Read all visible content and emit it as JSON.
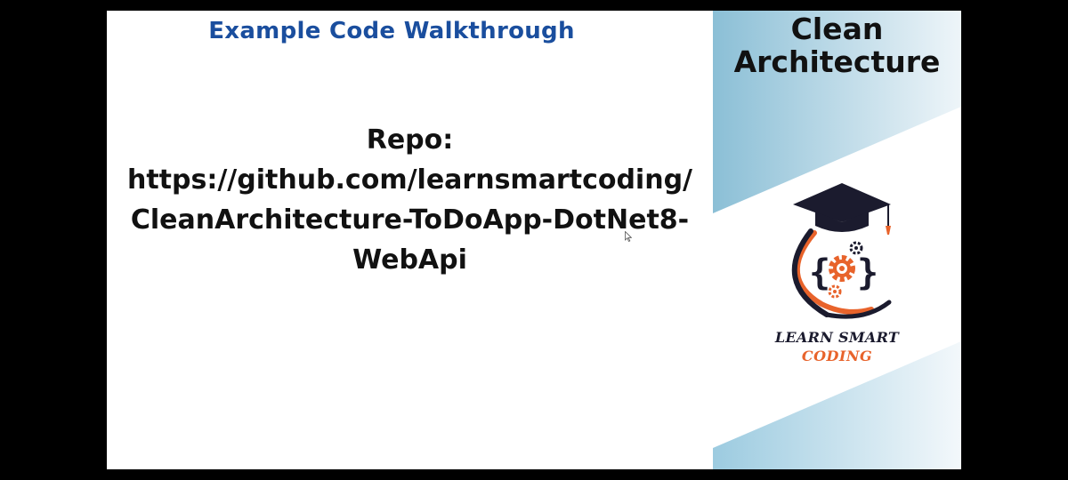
{
  "slide": {
    "title": "Example Code Walkthrough",
    "title_color": "#1a4e9e",
    "repo_lines": [
      "Repo:",
      "https://github.com/learnsmartcoding/",
      "CleanArchitecture-ToDoApp-DotNet8-",
      "WebApi"
    ]
  },
  "sidebar": {
    "title_lines": [
      "Clean",
      "Architecture"
    ],
    "brand_line1": "LEARN SMART",
    "brand_line2": "CODING",
    "brand_colors": {
      "navy": "#1b1b2e",
      "orange": "#e8632b",
      "accent_blue": "#8bbfd6"
    },
    "logo_icon": "graduation-cap-gear-logo"
  }
}
